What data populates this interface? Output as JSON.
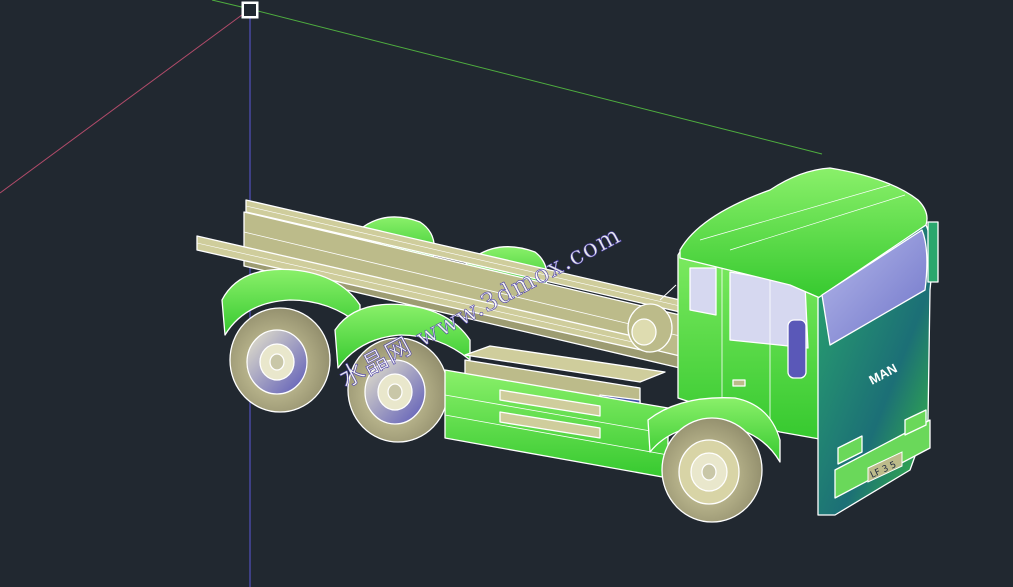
{
  "viewport": {
    "background": "#212830",
    "axis_colors": {
      "x": "#4fae3f",
      "y": "#5b58d8",
      "z": "#b14b6a"
    }
  },
  "model": {
    "cab_badge": "MAN",
    "plate": "LF 3 5"
  },
  "watermark": {
    "text": "水晶网 www.3dmox.com"
  }
}
